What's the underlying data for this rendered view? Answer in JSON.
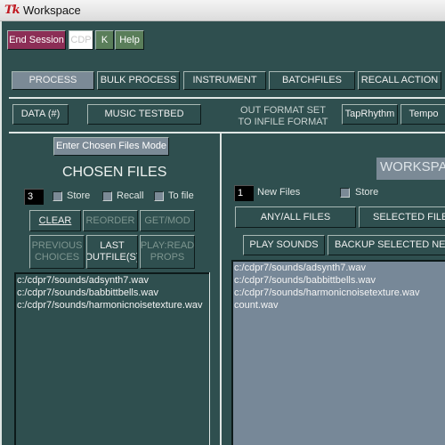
{
  "window": {
    "title": "Workspace",
    "logo": "Tk"
  },
  "top_buttons": {
    "end_session": "End Session",
    "cdp": "CDP",
    "k": "K",
    "help": "Help"
  },
  "tabs": [
    {
      "label": "PROCESS",
      "selected": true
    },
    {
      "label": "BULK PROCESS",
      "selected": false
    },
    {
      "label": "INSTRUMENT",
      "selected": false
    },
    {
      "label": "BATCHFILES",
      "selected": false
    },
    {
      "label": "RECALL ACTION",
      "selected": false
    }
  ],
  "row2": {
    "data": "DATA (#)",
    "music_testbed": "MUSIC TESTBED",
    "format_info_line1": "OUT FORMAT SET",
    "format_info_line2": "TO INFILE FORMAT",
    "tap_rhythm": "TapRhythm",
    "tempo": "Tempo"
  },
  "chosen": {
    "enter_mode_button": "Enter Chosen Files Mode",
    "heading": "CHOSEN FILES",
    "count": "3",
    "store_label": "Store",
    "recall_label": "Recall",
    "tofile_label": "To file",
    "clear": "CLEAR",
    "reorder": "REORDER",
    "getmod": "GET/MOD",
    "previous_line1": "PREVIOUS",
    "previous_line2": "CHOICES",
    "last_line1": "LAST",
    "last_line2": "OUTFILE(S)",
    "play_line1": "PLAY:READ",
    "play_line2": "PROPS",
    "files": [
      "c:/cdpr7/sounds/adsynth7.wav",
      "c:/cdpr7/sounds/babbittbells.wav",
      "c:/cdpr7/sounds/harmonicnoisetexture.wav"
    ]
  },
  "workspace": {
    "heading": "WORKSPACE",
    "new_count": "1",
    "new_files_label": "New Files",
    "store_label": "Store",
    "any_all": "ANY/ALL FILES",
    "selected_files": "SELECTED FILES ONLY",
    "play_sounds": "PLAY SOUNDS",
    "backup": "BACKUP SELECTED NEW FILES",
    "files": [
      "c:/cdpr7/sounds/adsynth7.wav",
      "c:/cdpr7/sounds/babbittbells.wav",
      "c:/cdpr7/sounds/harmonicnoisetexture.wav",
      "count.wav"
    ]
  }
}
